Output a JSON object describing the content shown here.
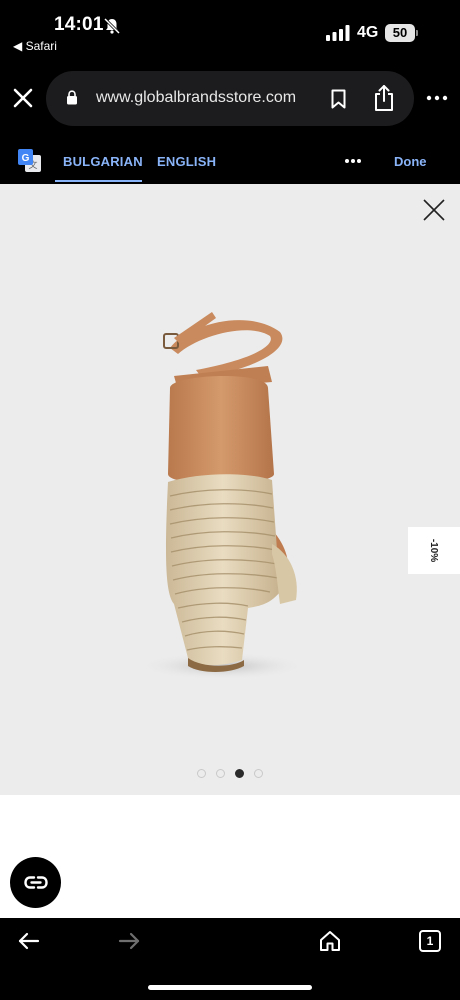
{
  "status_bar": {
    "time": "14:01",
    "back_app": "◀ Safari",
    "network": "4G",
    "battery": "50"
  },
  "browser": {
    "url": "www.globalbrandsstore.com",
    "icons": [
      "close-icon",
      "lock-icon",
      "bookmark-icon",
      "share-icon",
      "more-icon"
    ]
  },
  "translate": {
    "languages": [
      "BULGARIAN",
      "ENGLISH"
    ],
    "selected": "BULGARIAN",
    "done_label": "Done"
  },
  "product": {
    "discount": "-10%",
    "gallery_total": 4,
    "gallery_active": 3
  },
  "toolbar": {
    "tab_count": "1"
  },
  "colors": {
    "accent": "#8ab4f8",
    "gallery_bg": "#ececec",
    "chrome_bg": "#000000"
  }
}
